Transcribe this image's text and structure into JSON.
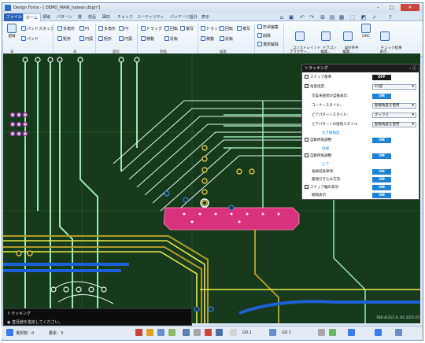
{
  "window": {
    "title": "Design Force - [ DEMO_MAIN_hateen.dbgn*]"
  },
  "menu": {
    "tabs": [
      "ファイル",
      "ホーム",
      "領域",
      "パターン",
      "層",
      "部品",
      "図形",
      "チェック",
      "ユーティリティ",
      "パッケージ設計",
      "表示"
    ]
  },
  "ribbon": {
    "connect": "配線",
    "pad_stack": "パッドスタック",
    "pad": "パッド",
    "circle": "円",
    "rect": "矩形",
    "arc": "円弧",
    "polygon": "多角形",
    "drag": "ドラッグ",
    "rotate": "回転",
    "mirror": "反転",
    "move": "移動",
    "copy": "複写",
    "delete": "削除",
    "shape_edit": "形状編集",
    "select_clear": "選択解除",
    "constraint_browser": "コンストレイント\nブラウザー...",
    "dragon_edit": "ドラゴン\n編集...",
    "design_edit": "設計条件\n編集...",
    "drc": "DRC",
    "check_display": "チェック結果\n表示...",
    "groups": [
      "表",
      "表",
      "図形",
      "移動",
      "編集"
    ]
  },
  "panel": {
    "title": "トラッキング",
    "rows": [
      {
        "label": "スナップ基準:",
        "value": "OFF"
      },
      {
        "label": "角度指定:",
        "value": "45度"
      },
      {
        "label": "交差未接続の自動表示:",
        "value": "ON"
      },
      {
        "label": "コーナースタイル:",
        "value": "配線角度を使用"
      },
      {
        "label": "ビアパターンスタイル:",
        "value": "ボックス"
      },
      {
        "label": "ビアパターンの接続スタイル:",
        "value": "配線角度を使用"
      },
      {
        "label": "自動時角調整:",
        "value": "ON"
      },
      {
        "label": "自動時角調整:",
        "value": "ON"
      },
      {
        "label": "長線延長保持:",
        "value": "ON"
      },
      {
        "label": "最適引き込み方向:",
        "value": "ON"
      },
      {
        "label": "スナップ軸の表示:",
        "value": "ON"
      },
      {
        "label": "間隔表示:",
        "value": "ON"
      }
    ],
    "sections": [
      "引き線角度",
      "斜線",
      "ビア"
    ]
  },
  "hint": {
    "title": "トラッキング",
    "message": "直径値を指定してください。"
  },
  "coords": "180.4(315.0, 65.32(5.07))",
  "status": {
    "selected": "選択数：0",
    "objects": "要素：3",
    "grid": "G0.1",
    "grid2": "G0.1"
  },
  "chart_colors": {
    "board": "#173a1d",
    "trace_light": "#9be8b3",
    "trace_white": "#e9f2ee",
    "via_yellow": "#e8e84a",
    "pad_pink": "#d8327c",
    "trace_blue": "#1c5fd6",
    "trace_gold": "#b09a2a"
  }
}
